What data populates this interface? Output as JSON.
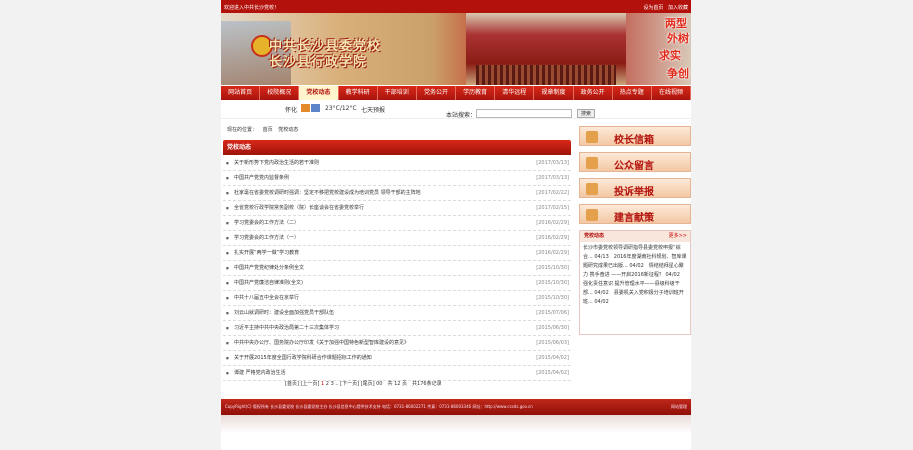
{
  "topbar": {
    "welcome": "欢迎进入中共长沙党校！",
    "links": [
      "设为首页",
      "加入收藏"
    ]
  },
  "banner": {
    "title_line1": "中共长沙县委党校",
    "title_line2": "长沙县行政学院",
    "slogan": [
      "两型",
      "外树",
      "求实",
      "争创"
    ]
  },
  "nav": [
    "网站首页",
    "校院概况",
    "党校动态",
    "教学科研",
    "干部培训",
    "党务公开",
    "学历教育",
    "清华远程",
    "规章制度",
    "政务公开",
    "热点专题",
    "在线视频"
  ],
  "nav_active_index": 2,
  "info": {
    "city": "怀化",
    "temp": "23°C/12°C",
    "forecast": "七天预报",
    "search_label": "本站搜索：",
    "search_value": "",
    "search_button": "搜索"
  },
  "breadcrumb": [
    "现在的位置：",
    "首页",
    "党校动态"
  ],
  "news": {
    "title": "党校动态",
    "items": [
      {
        "text": "关于新形势下党内政治生活的若干准则",
        "date": "[2017/03/13]"
      },
      {
        "text": "中国共产党党内监督条例",
        "date": "[2017/03/13]"
      },
      {
        "text": "杜家毫在省委党校调研时强调：坚定不移把党校建设成为培训党员 领导干部的主阵地",
        "date": "[2017/02/22]"
      },
      {
        "text": "全省党校行政学院常务副校（院）长座谈会在省委党校举行",
        "date": "[2017/02/15]"
      },
      {
        "text": "学习党委会的工作方法（二）",
        "date": "[2016/02/29]"
      },
      {
        "text": "学习党委会的工作方法（一）",
        "date": "[2016/02/29]"
      },
      {
        "text": "扎实开展“两学一做”学习教育",
        "date": "[2016/02/29]"
      },
      {
        "text": "中国共产党党纪律处分条例全文",
        "date": "[2015/10/30]"
      },
      {
        "text": "中国共产党廉洁自律准则(全文)",
        "date": "[2015/10/30]"
      },
      {
        "text": "中共十八届五中全会在京举行",
        "date": "[2015/10/30]"
      },
      {
        "text": "刘云山就调研时：建设全面加强党员干部队伍",
        "date": "[2015/07/06]"
      },
      {
        "text": "习近平主持中共中央政治局第二十三次集体学习",
        "date": "[2015/06/30]"
      },
      {
        "text": "中共中央办公厅、国务院办公厅印发《关于加强中国特色新型智库建设的意见》",
        "date": "[2015/06/03]"
      },
      {
        "text": "关于开展2015年度全国行政学院科研合作课题招标工作的通知",
        "date": "[2015/04/02]"
      },
      {
        "text": "谭建 严格党内政治生活",
        "date": "[2015/04/02]"
      }
    ]
  },
  "pager": {
    "first": "[首页]",
    "prev": "[上一页]",
    "pages": [
      "1",
      "2",
      "3"
    ],
    "ellipsis": "..",
    "next": "[下一页]",
    "last": "[尾页]",
    "summary": "00　共 12 页　共176条记录"
  },
  "right": {
    "buttons": [
      "校长信箱",
      "公众留言",
      "投诉举报",
      "建言献策"
    ],
    "news_title": "党校动态",
    "news_more": "更多>>",
    "news_text": "长沙市委党校领导调研指导县委党校申报“综合... 04/13　2016年度湖南社科规划、智库课题研究成果已出版... 04/02　情结结拜星心聚力 携手奋进 ——开启2016新征程？ 04/02　强化责任意识 提升管理水平——县级科级干部... 04/02　县委机关入党积极分子培训班开班... 04/02"
  },
  "footer": {
    "text": "CopyRight(C) 版权所有 长沙县委党校 长沙县委党校主办 长沙县信息中心提供技术支持 电话：0731-86002271 传真：0731-86003346 网址：http://www.cssds.gov.cn",
    "right": "网站管理"
  }
}
